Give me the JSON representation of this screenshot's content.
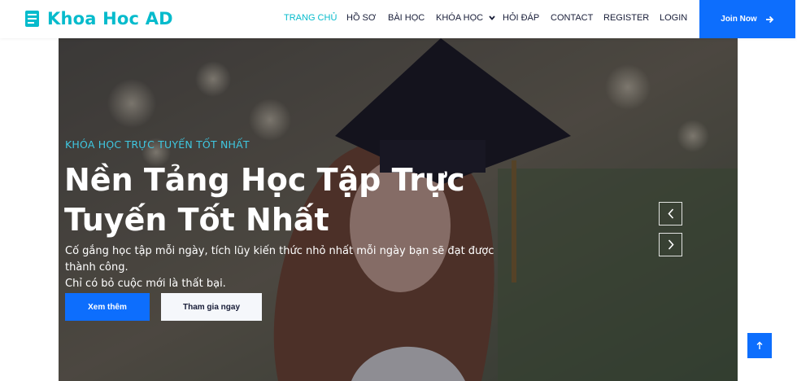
{
  "brand": {
    "name": "Khoa Hoc AD",
    "icon": "book-icon",
    "color": "#06bbcc"
  },
  "nav": {
    "items": [
      {
        "label": "TRANG CHỦ",
        "active": true
      },
      {
        "label": "HỒ SƠ",
        "active": false
      },
      {
        "label": "BÀI HỌC",
        "active": false
      },
      {
        "label": "KHÓA HỌC",
        "active": false,
        "dropdown": true
      },
      {
        "label": "HỎI ĐÁP",
        "active": false
      },
      {
        "label": "CONTACT",
        "active": false
      },
      {
        "label": "REGISTER",
        "active": false
      },
      {
        "label": "LOGIN",
        "active": false
      }
    ],
    "join_label": "Join Now",
    "join_icon": "arrow-right-icon"
  },
  "hero": {
    "eyebrow": "KHÓA HỌC TRỰC TUYẾN TỐT NHẤT",
    "title_line1": "Nền Tảng Học Tập Trực",
    "title_line2": "Tuyến Tốt Nhất",
    "desc_line1": "Cố gắng học tập mỗi ngày, tích lũy kiến thức nhỏ nhất mỗi ngày bạn sẽ đạt được thành công.",
    "desc_line2": "Chỉ có bỏ cuộc mới là thất bại.",
    "primary_button": "Xem thêm",
    "secondary_button": "Tham gia ngay"
  },
  "colors": {
    "primary": "#0d6efd",
    "accent": "#06bbcc",
    "text_dark": "#181d38"
  }
}
